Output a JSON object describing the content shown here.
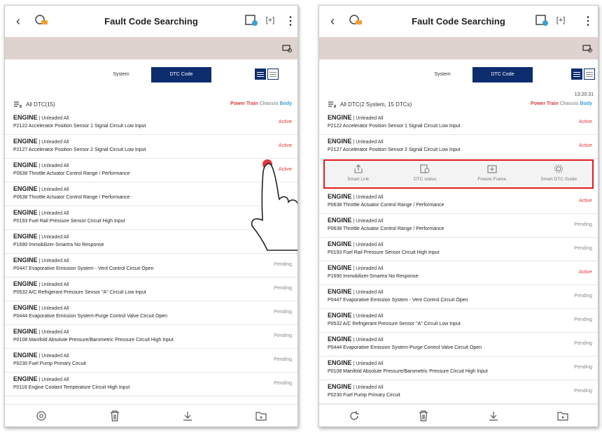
{
  "left": {
    "title": "Fault Code Searching",
    "tabs": [
      {
        "label": "System"
      },
      {
        "label": "DTC Code"
      }
    ],
    "header": {
      "label": "All DTC(15)",
      "filters": [
        "Power Train",
        "Chassis",
        "Body"
      ]
    },
    "rows": [
      {
        "system": "ENGINE",
        "variant": "Unleaded All",
        "desc": "P2122 Accelerator Position Sensor 1 Signal Circuit Low Input",
        "status": "Active"
      },
      {
        "system": "ENGINE",
        "variant": "Unleaded All",
        "desc": "P2127 Accelerator Position Sensor 2 Signal Circuit Low Input",
        "status": "Active"
      },
      {
        "system": "ENGINE",
        "variant": "Unleaded All",
        "desc": "P0638 Throttle Actuator Control Range / Performance",
        "status": "Active"
      },
      {
        "system": "ENGINE",
        "variant": "Unleaded All",
        "desc": "P0638 Throttle Actuator Control Range / Performance",
        "status": ""
      },
      {
        "system": "ENGINE",
        "variant": "Unleaded All",
        "desc": "P0193 Fuel Rail Pressure Sensor Circuit High Input",
        "status": ""
      },
      {
        "system": "ENGINE",
        "variant": "Unleaded All",
        "desc": "P1690 Immobilizer-Smartra No Response",
        "status": ""
      },
      {
        "system": "ENGINE",
        "variant": "Unleaded All",
        "desc": "P0447 Evaporative Emission System - Vent Control Circuit Open",
        "status": "Pending"
      },
      {
        "system": "ENGINE",
        "variant": "Unleaded All",
        "desc": "P0532 A/C Refrigerant Pressure Sensor \"A\" Circuit Low Input",
        "status": "Pending"
      },
      {
        "system": "ENGINE",
        "variant": "Unleaded All",
        "desc": "P0444 Evaporative Emission System-Purge Control Valve Circuit Open",
        "status": "Pending"
      },
      {
        "system": "ENGINE",
        "variant": "Unleaded All",
        "desc": "P0108 Manifold Absolute Pressure/Barometric Pressure Circuit High Input",
        "status": "Pending"
      },
      {
        "system": "ENGINE",
        "variant": "Unleaded All",
        "desc": "P0230 Fuel Pump Primary Circuit",
        "status": "Pending"
      },
      {
        "system": "ENGINE",
        "variant": "Unleaded All",
        "desc": "P0118 Engine Coolant Temperature Circuit High Input",
        "status": "Pending"
      }
    ]
  },
  "right": {
    "title": "Fault Code Searching",
    "tabs": [
      {
        "label": "System"
      },
      {
        "label": "DTC Code"
      }
    ],
    "header": {
      "label": "All DTC(2 System, 15 DTCs)",
      "filters": [
        "Power Train",
        "Chassis",
        "Body"
      ],
      "time": "13:20:31"
    },
    "rows_top": [
      {
        "system": "ENGINE",
        "variant": "Unleaded All",
        "desc": "P2122 Accelerator Position Sensor 1 Signal Circuit Low Input",
        "status": "Active"
      },
      {
        "system": "ENGINE",
        "variant": "Unleaded All",
        "desc": "P2127 Accelerator Position Sensor 2 Signal Circuit Low Input",
        "status": "Active"
      }
    ],
    "actions": [
      {
        "label": "Smart Link"
      },
      {
        "label": "DTC status"
      },
      {
        "label": "Freeze Frame"
      },
      {
        "label": "Smart DTC Guide"
      }
    ],
    "rows_bottom": [
      {
        "system": "ENGINE",
        "variant": "Unleaded All",
        "desc": "P0638 Throttle Actuator Control Range / Performance",
        "status": "Active"
      },
      {
        "system": "ENGINE",
        "variant": "Unleaded All",
        "desc": "P0638 Throttle Actuator Control Range / Performance",
        "status": "Pending"
      },
      {
        "system": "ENGINE",
        "variant": "Unleaded All",
        "desc": "P0193 Fuel Rail Pressure Sensor Circuit High Input",
        "status": "Pending"
      },
      {
        "system": "ENGINE",
        "variant": "Unleaded All",
        "desc": "P1690 Immobilizer-Smartra No Response",
        "status": "Active"
      },
      {
        "system": "ENGINE",
        "variant": "Unleaded All",
        "desc": "P0447 Evaporative Emission System - Vent Control Circuit Open",
        "status": "Pending"
      },
      {
        "system": "ENGINE",
        "variant": "Unleaded All",
        "desc": "P0532 A/C Refrigerant Pressure Sensor \"A\" Circuit Low Input",
        "status": "Pending"
      },
      {
        "system": "ENGINE",
        "variant": "Unleaded All",
        "desc": "P0444 Evaporative Emission System-Purge Control Valve Circuit Open",
        "status": "Pending"
      },
      {
        "system": "ENGINE",
        "variant": "Unleaded All",
        "desc": "P0108 Manifold Absolute Pressure/Barometric Pressure Circuit High Input",
        "status": "Pending"
      },
      {
        "system": "ENGINE",
        "variant": "Unleaded All",
        "desc": "P0230 Fuel Pump Primary Circuit",
        "status": "Pending"
      }
    ]
  },
  "colors": {
    "accent": "#0d2d6e",
    "active": "#e03a3a",
    "highlight": "#e21b1b",
    "banner": "#ded3cf"
  },
  "icons": [
    "back-icon",
    "car-icon",
    "ecu-icon",
    "fullscreen-icon",
    "more-icon",
    "vehicle-icon",
    "list-view-icon",
    "grid-view-icon",
    "share-icon",
    "status-icon",
    "freeze-frame-icon",
    "guide-icon",
    "home-icon",
    "refresh-icon",
    "delete-icon",
    "download-icon",
    "folder-icon"
  ]
}
